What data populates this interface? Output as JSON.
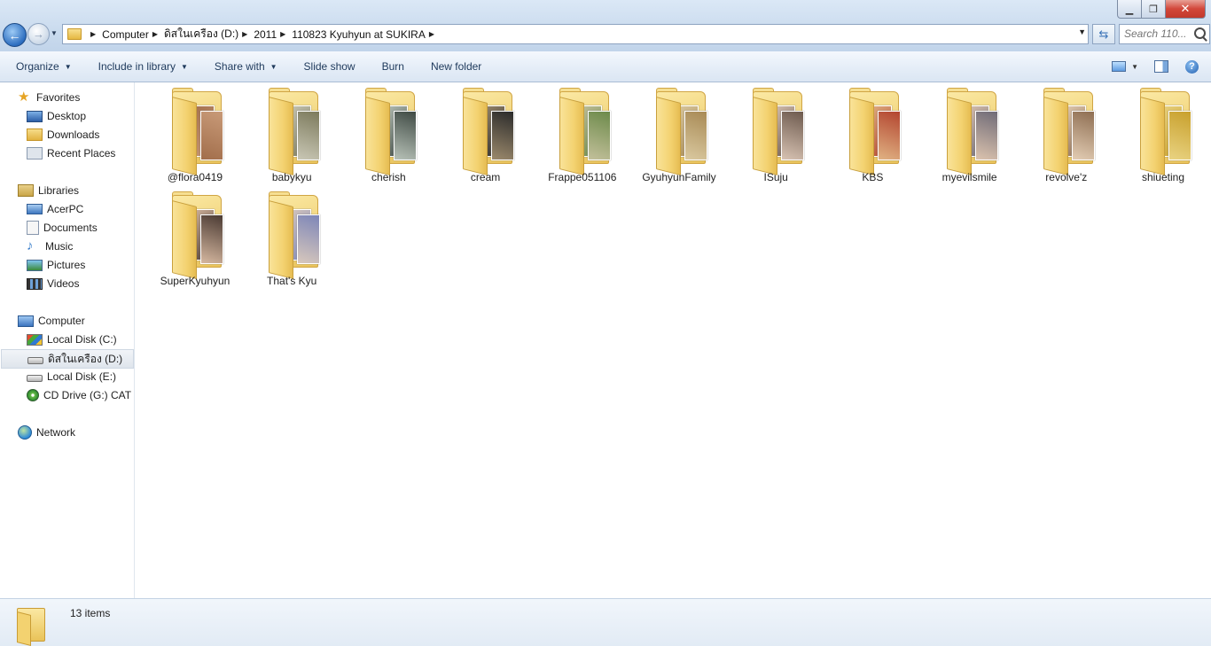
{
  "address": {
    "crumbs": [
      "Computer",
      "ดิสในเครือง (D:)",
      "2011",
      "110823 Kyuhyun at SUKIRA"
    ]
  },
  "search": {
    "placeholder": "Search 110..."
  },
  "toolbar": {
    "organize": "Organize",
    "include_in_library": "Include in library",
    "share_with": "Share with",
    "slide_show": "Slide show",
    "burn": "Burn",
    "new_folder": "New folder",
    "help": "?"
  },
  "nav": {
    "favorites": "Favorites",
    "desktop": "Desktop",
    "downloads": "Downloads",
    "recent_places": "Recent Places",
    "libraries": "Libraries",
    "acerpc": "AcerPC",
    "documents": "Documents",
    "music": "Music",
    "pictures": "Pictures",
    "videos": "Videos",
    "computer": "Computer",
    "local_c": "Local Disk (C:)",
    "disk_d": "ดิสในเครือง (D:)",
    "local_e": "Local Disk (E:)",
    "cd_drive": "CD Drive (G:) CAT (",
    "network": "Network"
  },
  "folders": [
    {
      "label": "@flora0419",
      "thumb": [
        "#c89a78",
        "#a26e4b"
      ]
    },
    {
      "label": "babykyu",
      "thumb": [
        "#7c7a5c",
        "#c9c7b5"
      ]
    },
    {
      "label": "cherish",
      "thumb": [
        "#3f4a44",
        "#b8c2b8"
      ]
    },
    {
      "label": "cream",
      "thumb": [
        "#2b2b2b",
        "#9c8a6c"
      ]
    },
    {
      "label": "Frappe051106",
      "thumb": [
        "#6c8a4a",
        "#c3c09b"
      ]
    },
    {
      "label": "GyuhyunFamily",
      "thumb": [
        "#a88a55",
        "#dac9a0"
      ]
    },
    {
      "label": "ISuju",
      "thumb": [
        "#6d5a4e",
        "#d8c3b3"
      ]
    },
    {
      "label": "KBS",
      "thumb": [
        "#b3452f",
        "#e0b283"
      ]
    },
    {
      "label": "myevilsmile",
      "thumb": [
        "#6f6b77",
        "#dcc3ae"
      ]
    },
    {
      "label": "revolve'z",
      "thumb": [
        "#8e6e52",
        "#e3cdb4"
      ]
    },
    {
      "label": "shiueting",
      "thumb": [
        "#c8a02c",
        "#e9d382"
      ]
    },
    {
      "label": "SuperKyuhyun",
      "thumb": [
        "#4a3a33",
        "#d6b8a0"
      ]
    },
    {
      "label": "That's Kyu",
      "thumb": [
        "#7d86b8",
        "#d8c8bc"
      ]
    }
  ],
  "status": {
    "item_count": "13 items"
  },
  "colors": {
    "accent": "#1e395b",
    "folder": "#f3d270",
    "close": "#c23a2c"
  }
}
